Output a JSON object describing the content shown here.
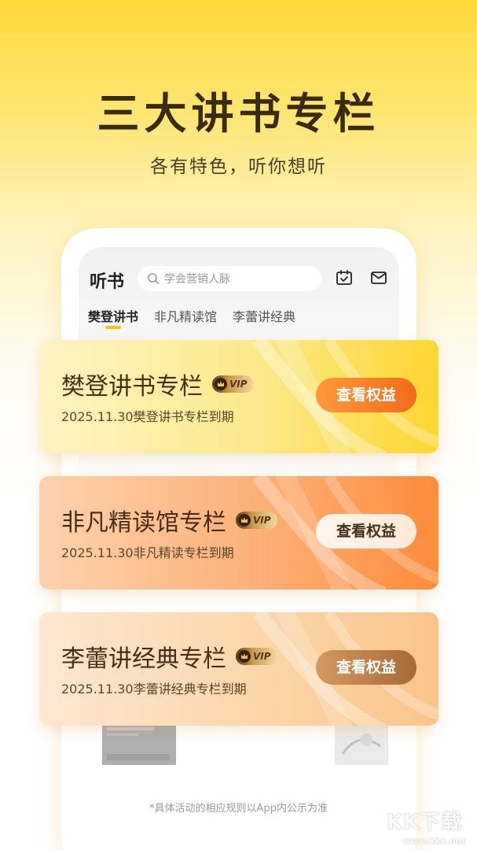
{
  "hero": {
    "title": "三大讲书专栏",
    "subtitle": "各有特色，听你想听"
  },
  "app": {
    "title": "听书",
    "search_placeholder": "学会营销人脉",
    "icons": [
      "search-icon",
      "calendar-check-icon",
      "mail-icon"
    ],
    "tabs": [
      {
        "label": "樊登讲书",
        "active": true
      },
      {
        "label": "非凡精读馆",
        "active": false
      },
      {
        "label": "李蕾讲经典",
        "active": false
      }
    ]
  },
  "cards": [
    {
      "title": "樊登讲书专栏",
      "badge": "VIP",
      "expiry": "2025.11.30樊登讲书专栏到期",
      "button": "查看权益",
      "colors": {
        "bg_start": "#fdf3c4",
        "bg_end": "#fdd630",
        "button_start": "#ff9a3d",
        "button_end": "#f46a1a",
        "button_text": "#ffffff"
      }
    },
    {
      "title": "非凡精读馆专栏",
      "badge": "VIP",
      "expiry": "2025.11.30非凡精读专栏到期",
      "button": "查看权益",
      "colors": {
        "bg_start": "#fcc9a0",
        "bg_end": "#ff8c3a",
        "button_start": "#fff6ee",
        "button_end": "#ffe9d8",
        "button_text": "#4a2e14"
      }
    },
    {
      "title": "李蕾讲经典专栏",
      "badge": "VIP",
      "expiry": "2025.11.30李蕾讲经典专栏到期",
      "button": "查看权益",
      "colors": {
        "bg_start": "#fde4c6",
        "bg_end": "#f9c48a",
        "button_start": "#d29a62",
        "button_end": "#a86a38",
        "button_text": "#ffffff"
      }
    }
  ],
  "footnote": "*具体活动的相应规则以App内公示为准",
  "watermark": {
    "text": "KK下载",
    "url": "www.kkx.net"
  }
}
